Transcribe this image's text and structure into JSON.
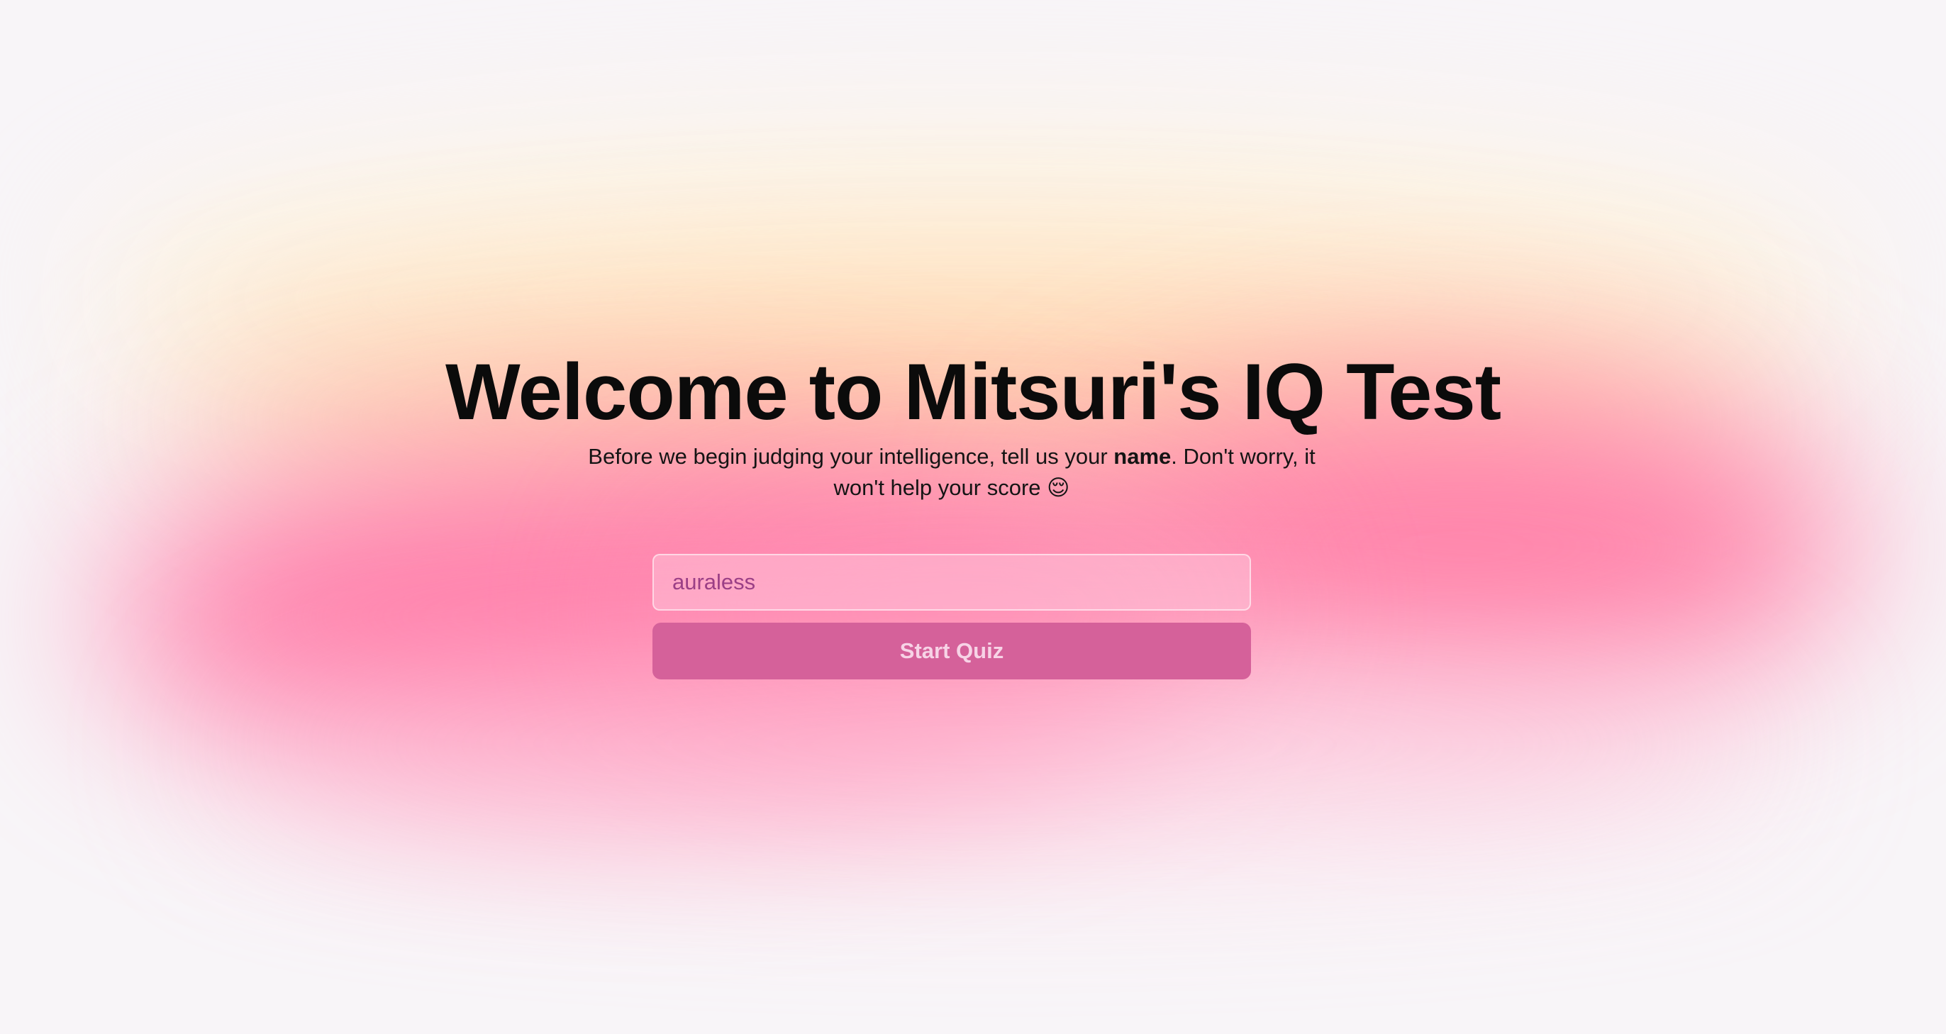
{
  "welcome": {
    "title": "Welcome to Mitsuri's IQ Test",
    "subtitle_before": "Before we begin judging your intelligence, tell us your ",
    "subtitle_emphasis": "name",
    "subtitle_after": ". Don't worry, it won't help your score 😌"
  },
  "form": {
    "name_value": "auraless",
    "start_label": "Start Quiz"
  },
  "colors": {
    "accent": "#d5619a",
    "input_text": "#9b3f86"
  }
}
